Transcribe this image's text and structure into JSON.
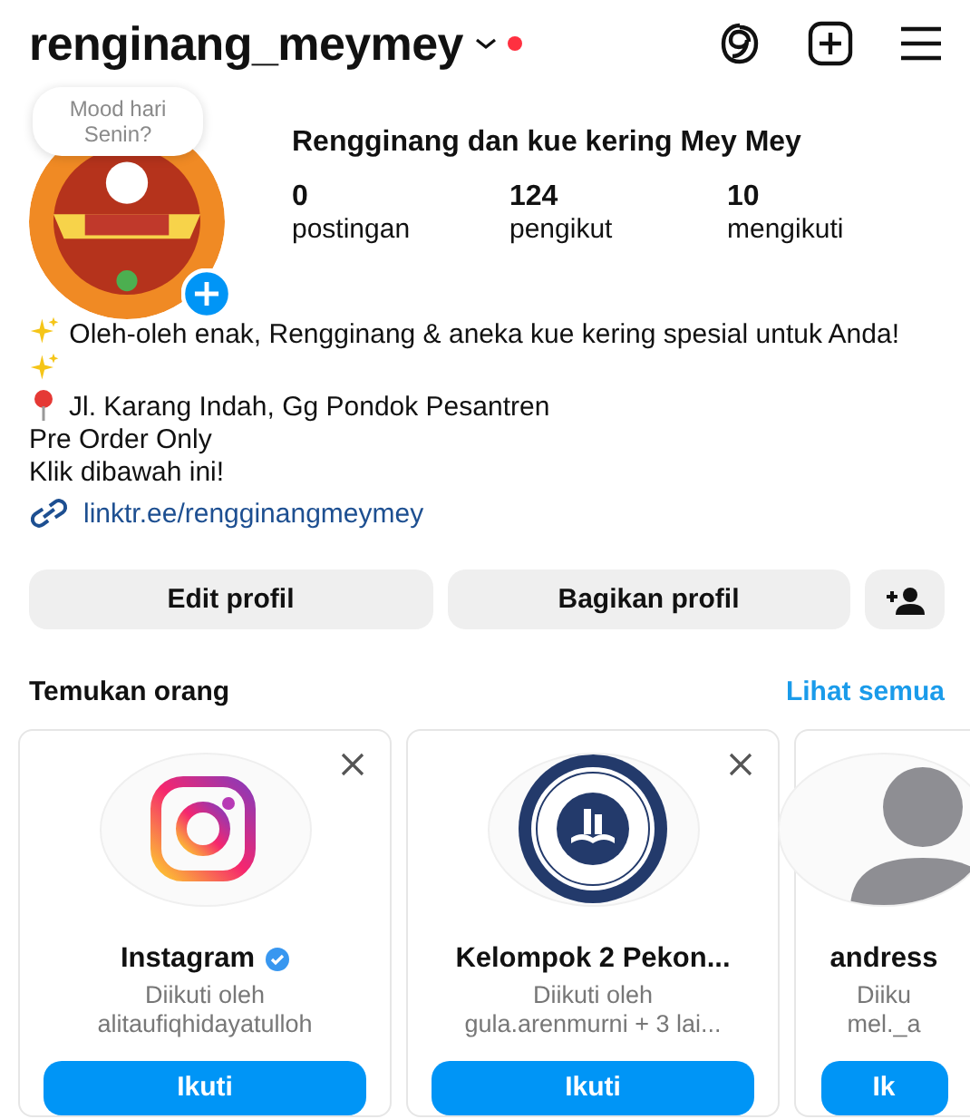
{
  "header": {
    "username": "renginang_meymey",
    "has_notification": true
  },
  "profile": {
    "note": "Mood hari Senin?",
    "name": "Rengginang dan kue kering Mey Mey",
    "stats": [
      {
        "value": "0",
        "label": "postingan"
      },
      {
        "value": "124",
        "label": "pengikut"
      },
      {
        "value": "10",
        "label": "mengikuti"
      }
    ]
  },
  "bio": [
    {
      "kind": "sparkles",
      "text": "Oleh-oleh enak, Rengginang & aneka kue kering spesial untuk Anda!"
    },
    {
      "kind": "pin",
      "text": "Jl. Karang Indah, Gg Pondok Pesantren"
    },
    {
      "kind": "plain",
      "text": "Pre Order Only"
    },
    {
      "kind": "plain",
      "text": "Klik dibawah ini!"
    }
  ],
  "link": "linktr.ee/rengginangmeymey",
  "buttons": [
    "Edit profil",
    "Bagikan profil"
  ],
  "suggestions": {
    "title": "Temukan orang",
    "see_all": "Lihat semua",
    "cards": [
      {
        "kind": "instagram",
        "name": "Instagram",
        "verified": true,
        "dismissable": true,
        "line_1": "Diikuti oleh",
        "line_2": "alitaufiqhidayatulloh",
        "button": "Ikuti"
      },
      {
        "kind": "emblem",
        "name": "Kelompok 2 Pekon...",
        "verified": false,
        "dismissable": true,
        "line_1": "Diikuti oleh",
        "line_2": "gula.arenmurni + 3 lai...",
        "button": "Ikuti"
      },
      {
        "kind": "default",
        "name": "andress",
        "verified": false,
        "dismissable": false,
        "line_1": "Diiku",
        "line_2": "mel._a",
        "button": "Ik"
      }
    ]
  }
}
